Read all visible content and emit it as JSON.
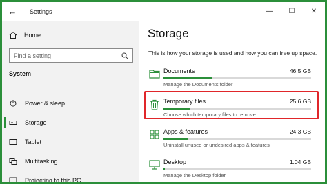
{
  "window": {
    "title": "Settings",
    "back_glyph": "←",
    "minimize_glyph": "—",
    "maximize_glyph": "☐",
    "close_glyph": "✕"
  },
  "sidebar": {
    "home_label": "Home",
    "search_placeholder": "Find a setting",
    "section_title": "System",
    "items": [
      {
        "label": "Power & sleep",
        "icon": "power-icon",
        "active": false
      },
      {
        "label": "Storage",
        "icon": "storage-drive-icon",
        "active": true
      },
      {
        "label": "Tablet",
        "icon": "tablet-icon",
        "active": false
      },
      {
        "label": "Multitasking",
        "icon": "multitasking-icon",
        "active": false
      },
      {
        "label": "Projecting to this PC",
        "icon": "projecting-icon",
        "active": false
      }
    ]
  },
  "main": {
    "title": "Storage",
    "description": "This is how your storage is used and how you can free up space.",
    "items": [
      {
        "name": "Documents",
        "size": "46.5 GB",
        "subtitle": "Manage the Documents folder",
        "icon": "documents-icon",
        "usage_fraction": 0.33
      },
      {
        "name": "Temporary files",
        "size": "25.6 GB",
        "subtitle": "Choose which temporary files to remove",
        "icon": "trash-icon",
        "usage_fraction": 0.18
      },
      {
        "name": "Apps & features",
        "size": "24.3 GB",
        "subtitle": "Uninstall unused or undesired apps & features",
        "icon": "apps-icon",
        "usage_fraction": 0.17
      },
      {
        "name": "Desktop",
        "size": "1.04 GB",
        "subtitle": "Manage the Desktop folder",
        "icon": "desktop-icon",
        "usage_fraction": 0.01
      }
    ]
  },
  "colors": {
    "accent": "#2b8f3a",
    "highlight": "#e0262a",
    "sidebar_bg": "#f2f2f2",
    "bar_track": "#d9d9d9"
  }
}
